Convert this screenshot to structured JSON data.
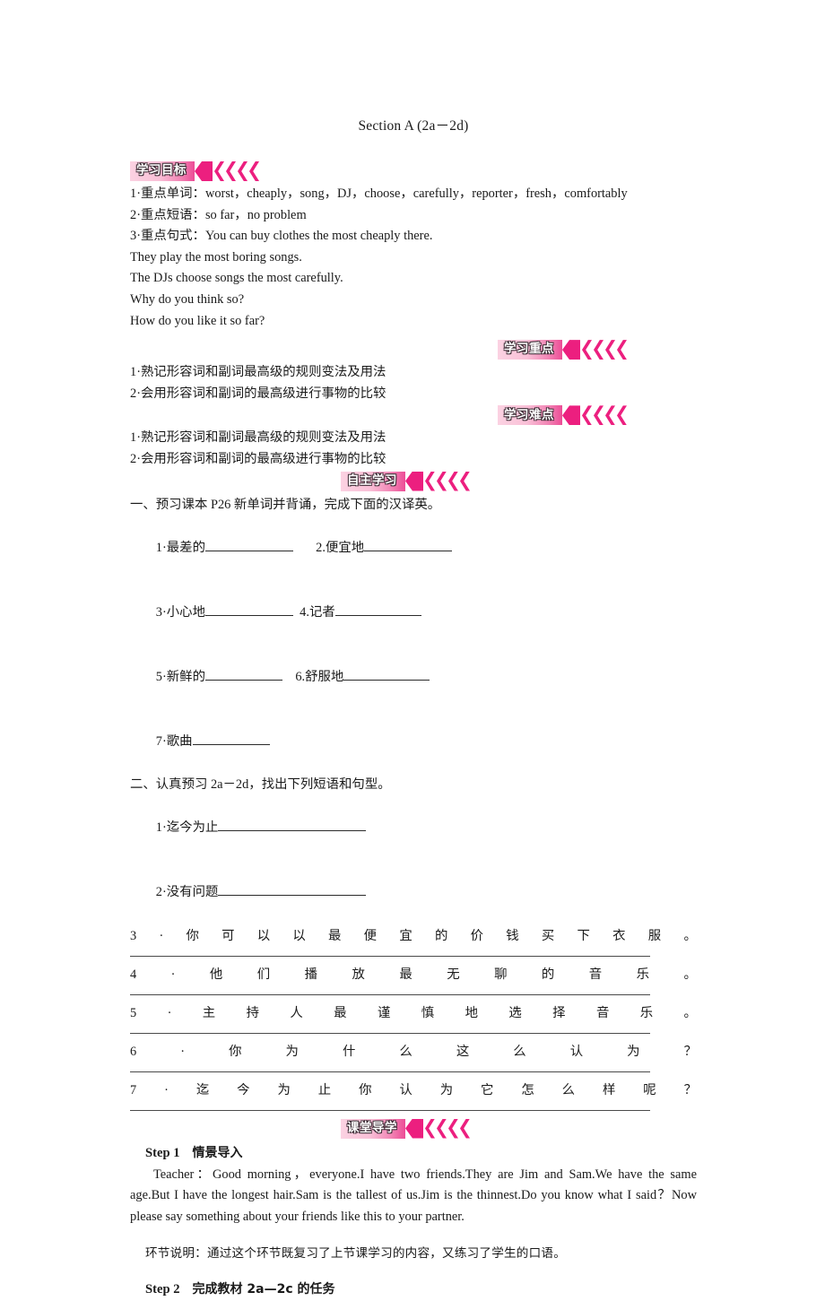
{
  "document": {
    "title": "Section A (2a－2d)"
  },
  "sections": {
    "goals": {
      "banner": "学习目标",
      "chevrons": 4,
      "lines": [
        "1·重点单词：worst，cheaply，song，DJ，choose，carefully，reporter，fresh，comfortably",
        "2·重点短语：so far，no problem",
        "3·重点句式：You can buy clothes the most cheaply there.",
        "They play the most boring songs.",
        "The DJs choose songs the most carefully.",
        "Why do you think so?",
        "How do you like it so far?"
      ]
    },
    "key_points": {
      "banner": "学习重点",
      "chevrons": 4,
      "lines": [
        "1·熟记形容词和副词最高级的规则变法及用法",
        "2·会用形容词和副词的最高级进行事物的比较"
      ]
    },
    "difficult_points": {
      "banner": "学习难点",
      "chevrons": 4,
      "lines": [
        "1·熟记形容词和副词最高级的规则变法及用法",
        "2·会用形容词和副词的最高级进行事物的比较"
      ]
    },
    "self_study": {
      "banner": "自主学习",
      "chevrons": 4,
      "task_one": "一、预习课本 P26 新单词并背诵，完成下面的汉译英。",
      "vocab": [
        {
          "num": "1·",
          "cn": "最差的"
        },
        {
          "num": "2.",
          "cn": "便宜地"
        },
        {
          "num": "3·",
          "cn": "小心地"
        },
        {
          "num": "4.",
          "cn": "记者"
        },
        {
          "num": "5·",
          "cn": "新鲜的"
        },
        {
          "num": "6.",
          "cn": "舒服地"
        },
        {
          "num": "7·",
          "cn": "歌曲"
        }
      ],
      "task_two": "二、认真预习 2a－2d，找出下列短语和句型。",
      "phrases": [
        {
          "num": "1·",
          "cn": "迄今为止"
        },
        {
          "num": "2·",
          "cn": "没有问题"
        }
      ],
      "sentences": [
        {
          "num": "3",
          "chars": [
            "·",
            "你",
            "可",
            "以",
            "以",
            "最",
            "便",
            "宜",
            "的",
            "价",
            "钱",
            "买",
            "下",
            "衣",
            "服",
            "。"
          ]
        },
        {
          "num": "4",
          "chars": [
            "·",
            "他",
            "们",
            "播",
            "放",
            "最",
            "无",
            "聊",
            "的",
            "音",
            "乐",
            "。"
          ]
        },
        {
          "num": "5",
          "chars": [
            "·",
            "主",
            "持",
            "人",
            "最",
            "谨",
            "慎",
            "地",
            "选",
            "择",
            "音",
            "乐",
            "。"
          ]
        },
        {
          "num": "6",
          "chars": [
            "·",
            "你",
            "为",
            "什",
            "么",
            "这",
            "么",
            "认",
            "为",
            "？"
          ]
        },
        {
          "num": "7",
          "chars": [
            "·",
            "迄",
            "今",
            "为",
            "止",
            "你",
            "认",
            "为",
            "它",
            "怎",
            "么",
            "样",
            "呢",
            "？"
          ]
        }
      ]
    },
    "class_guide": {
      "banner": "课堂导学",
      "chevrons": 4,
      "step1": {
        "label": "Step 1",
        "title": "情景导入",
        "body": "Teacher：Good morning，everyone.I have two friends.They are Jim and Sam.We have the same age.But I have the longest hair.Sam is the tallest of us.Jim is the thinnest.Do you know what I said？Now please say something about your friends like this to your partner."
      },
      "note": "环节说明：通过这个环节既复习了上节课学习的内容，又练习了学生的口语。",
      "step2": {
        "label": "Step 2",
        "title": "完成教材 2a—2c 的任务"
      }
    }
  },
  "theme": {
    "banner_gradient_start": "#fbd2e2",
    "banner_gradient_end": "#ec4d96",
    "chevron_color": "#ec1f7f",
    "text_color": "#1a1a1a",
    "page_background": "#ffffff"
  }
}
